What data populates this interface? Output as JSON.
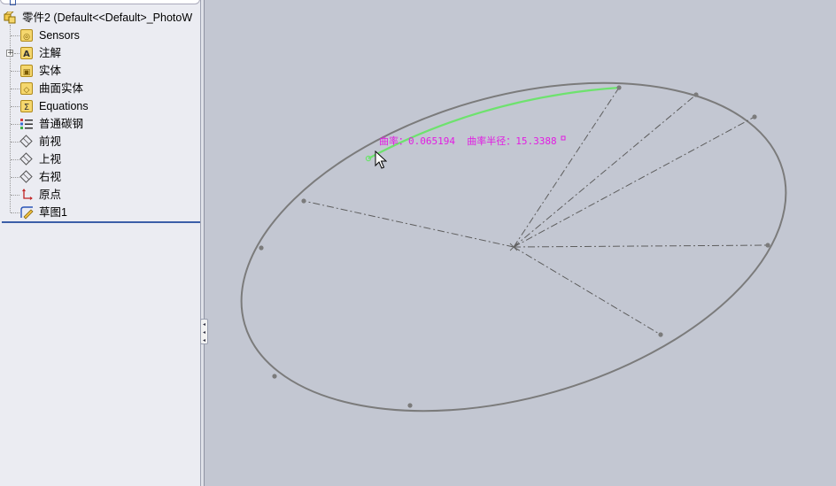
{
  "tree": {
    "root": {
      "label": "零件2  (Default<<Default>_PhotoW"
    },
    "items": [
      {
        "label": "Sensors",
        "icon": "sensors-folder-icon"
      },
      {
        "label": "注解",
        "icon": "annotations-icon"
      },
      {
        "label": "实体",
        "icon": "solid-bodies-icon"
      },
      {
        "label": "曲面实体",
        "icon": "surface-bodies-icon"
      },
      {
        "label": "Equations",
        "icon": "equations-icon"
      },
      {
        "label": "普通碳钢",
        "icon": "material-icon"
      },
      {
        "label": "前视",
        "icon": "plane-icon"
      },
      {
        "label": "上视",
        "icon": "plane-icon"
      },
      {
        "label": "右视",
        "icon": "plane-icon"
      },
      {
        "label": "原点",
        "icon": "origin-icon"
      },
      {
        "label": "草图1",
        "icon": "sketch-icon"
      }
    ]
  },
  "viewport": {
    "curvature": {
      "label": "曲率：0.065194  曲率半径：15.3388"
    }
  },
  "colors": {
    "viewport_bg": "#c3c7d2",
    "ellipse": "#7b7b7b",
    "highlight": "#6ee26e",
    "readout": "#e21ce3"
  }
}
